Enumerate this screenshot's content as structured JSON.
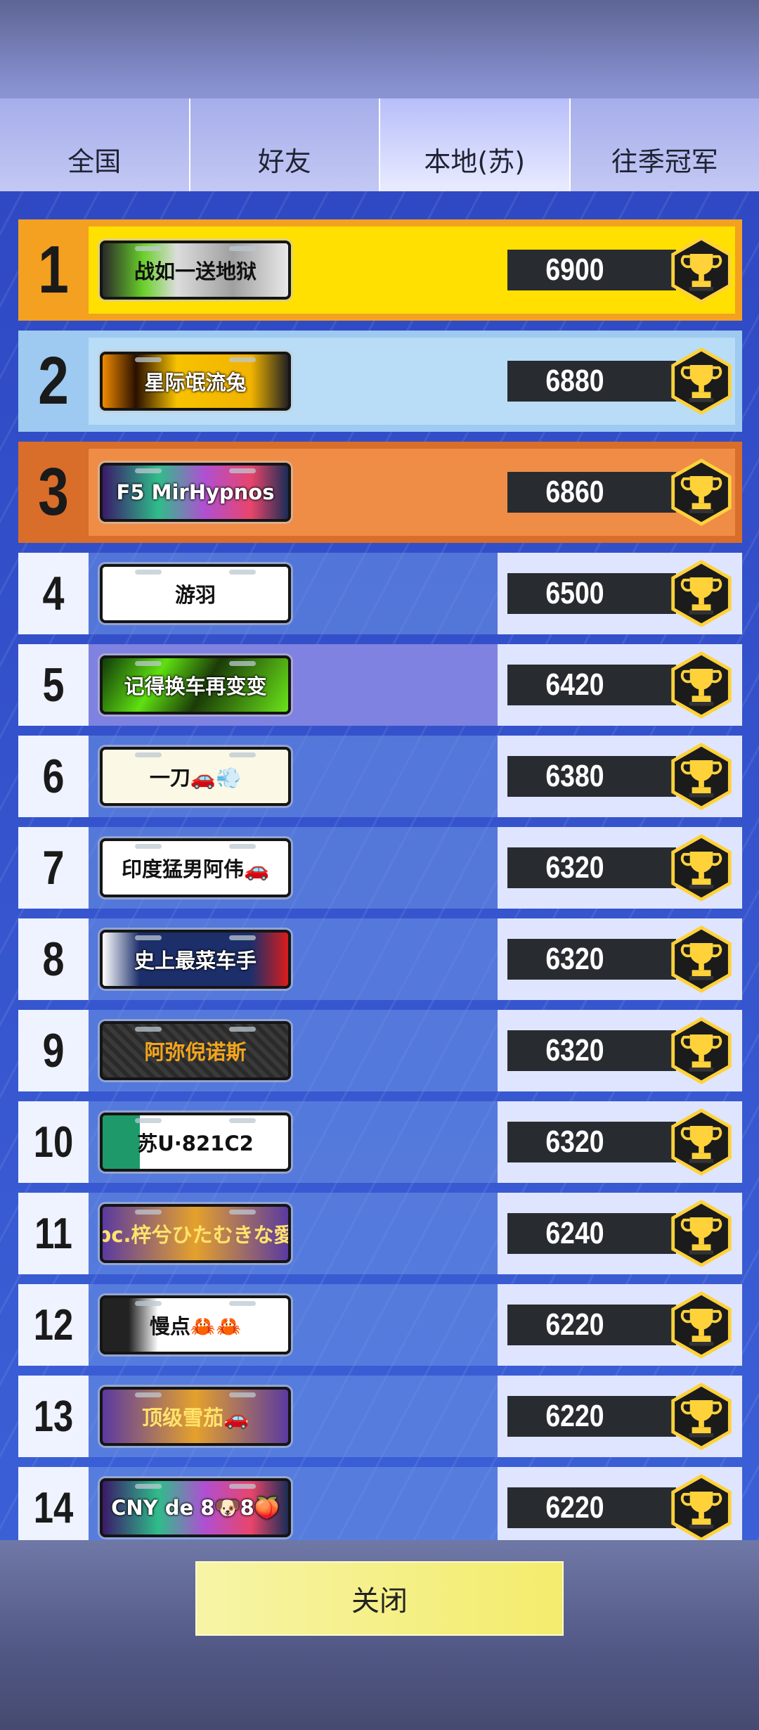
{
  "tabs": [
    {
      "label": "全国",
      "active": false
    },
    {
      "label": "好友",
      "active": false
    },
    {
      "label": "本地(苏)",
      "active": true
    },
    {
      "label": "往季冠军",
      "active": false
    }
  ],
  "leaderboard": [
    {
      "rank": "1",
      "name": "战如一送地狱",
      "score": "6900"
    },
    {
      "rank": "2",
      "name": "星际氓流兔",
      "score": "6880"
    },
    {
      "rank": "3",
      "name": "F5 MirHypnos",
      "score": "6860"
    },
    {
      "rank": "4",
      "name": "游羽",
      "score": "6500"
    },
    {
      "rank": "5",
      "name": "记得换车再变变",
      "score": "6420"
    },
    {
      "rank": "6",
      "name": "一刀🚗💨",
      "score": "6380"
    },
    {
      "rank": "7",
      "name": "印度猛男阿伟🚗",
      "score": "6320"
    },
    {
      "rank": "8",
      "name": "史上最菜车手",
      "score": "6320"
    },
    {
      "rank": "9",
      "name": "阿弥倪诺斯",
      "score": "6320"
    },
    {
      "rank": "10",
      "name": "苏U·821C2",
      "score": "6320"
    },
    {
      "rank": "11",
      "name": "pc.梓兮ひたむきな愛",
      "score": "6240"
    },
    {
      "rank": "12",
      "name": "慢点🦀🦀",
      "score": "6220"
    },
    {
      "rank": "13",
      "name": "顶级雪茄🚗",
      "score": "6220"
    },
    {
      "rank": "14",
      "name": "CNY de 8🐶8🍑",
      "score": "6220"
    }
  ],
  "colors": {
    "gold_row": "#ffe000",
    "gold_frame": "#f4a020",
    "silver_row": "#b9dcf7",
    "bronze_row": "#ef8c46",
    "highlight_row": "#7f82e0",
    "trophy_gold": "#ffd23a"
  },
  "icons": {
    "trophy": "trophy-icon"
  },
  "footer": {
    "close_label": "关闭"
  }
}
